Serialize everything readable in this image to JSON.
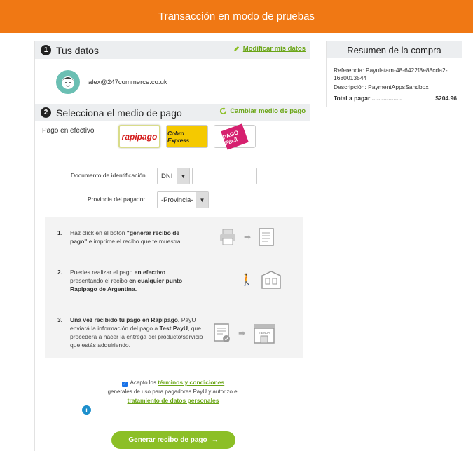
{
  "header": {
    "title": "Transacción en modo de pruebas"
  },
  "section1": {
    "number": "1",
    "title": "Tus datos",
    "link": "Modificar mis datos",
    "email": "alex@247commerce.co.uk"
  },
  "section2": {
    "number": "2",
    "title": "Selecciona el medio de pago",
    "link": "Cambiar medio de pago"
  },
  "payment": {
    "label": "Pago en efectivo",
    "methods": [
      "rapipago",
      "Cobro Express",
      "PAGO Fácil"
    ],
    "selected": "rapipago"
  },
  "form": {
    "doc_label": "Documento de identificación",
    "doc_type": "DNI",
    "doc_value": "",
    "province_label": "Provincia del pagador",
    "province_value": "-Provincia-"
  },
  "steps": [
    {
      "n": "1.",
      "pre": "Haz click en el botón ",
      "bold1": "\"generar recibo de pago\"",
      "post": " e imprime el recibo que te muestra."
    },
    {
      "n": "2.",
      "pre": "Puedes realizar el pago ",
      "bold1": "en efectivo",
      "mid": " presentando el recibo ",
      "bold2": "en cualquier punto Rapipago de Argentina."
    },
    {
      "n": "3.",
      "bold0": "Una vez recibido tu pago en Rapipago,",
      "pre": " PayU enviará la información del pago a ",
      "bold1": "Test PayU",
      "post": ", que procederá a hacer la entrega del producto/servicio que estás adquiriendo.",
      "store_label": "TIENDA"
    }
  ],
  "terms": {
    "accept": "Acepto los",
    "terms_link": "términos y condiciones",
    "middle": "generales de uso para pagadores PayU y autorizo el",
    "privacy_link": "tratamiento de datos personales",
    "checked": true
  },
  "button": {
    "label": "Generar recibo de pago",
    "arrow": "→"
  },
  "summary": {
    "title": "Resumen de la compra",
    "reference": "Referencia: Payulatam-48-6422f8e88cda2-1680013544",
    "description": "Descripción: PaymentAppsSandbox",
    "total_label": "Total a pagar ..................",
    "total_value": "$204.96"
  },
  "colors": {
    "accent": "#f07814",
    "green": "#8cbf26",
    "link": "#6aa516"
  }
}
